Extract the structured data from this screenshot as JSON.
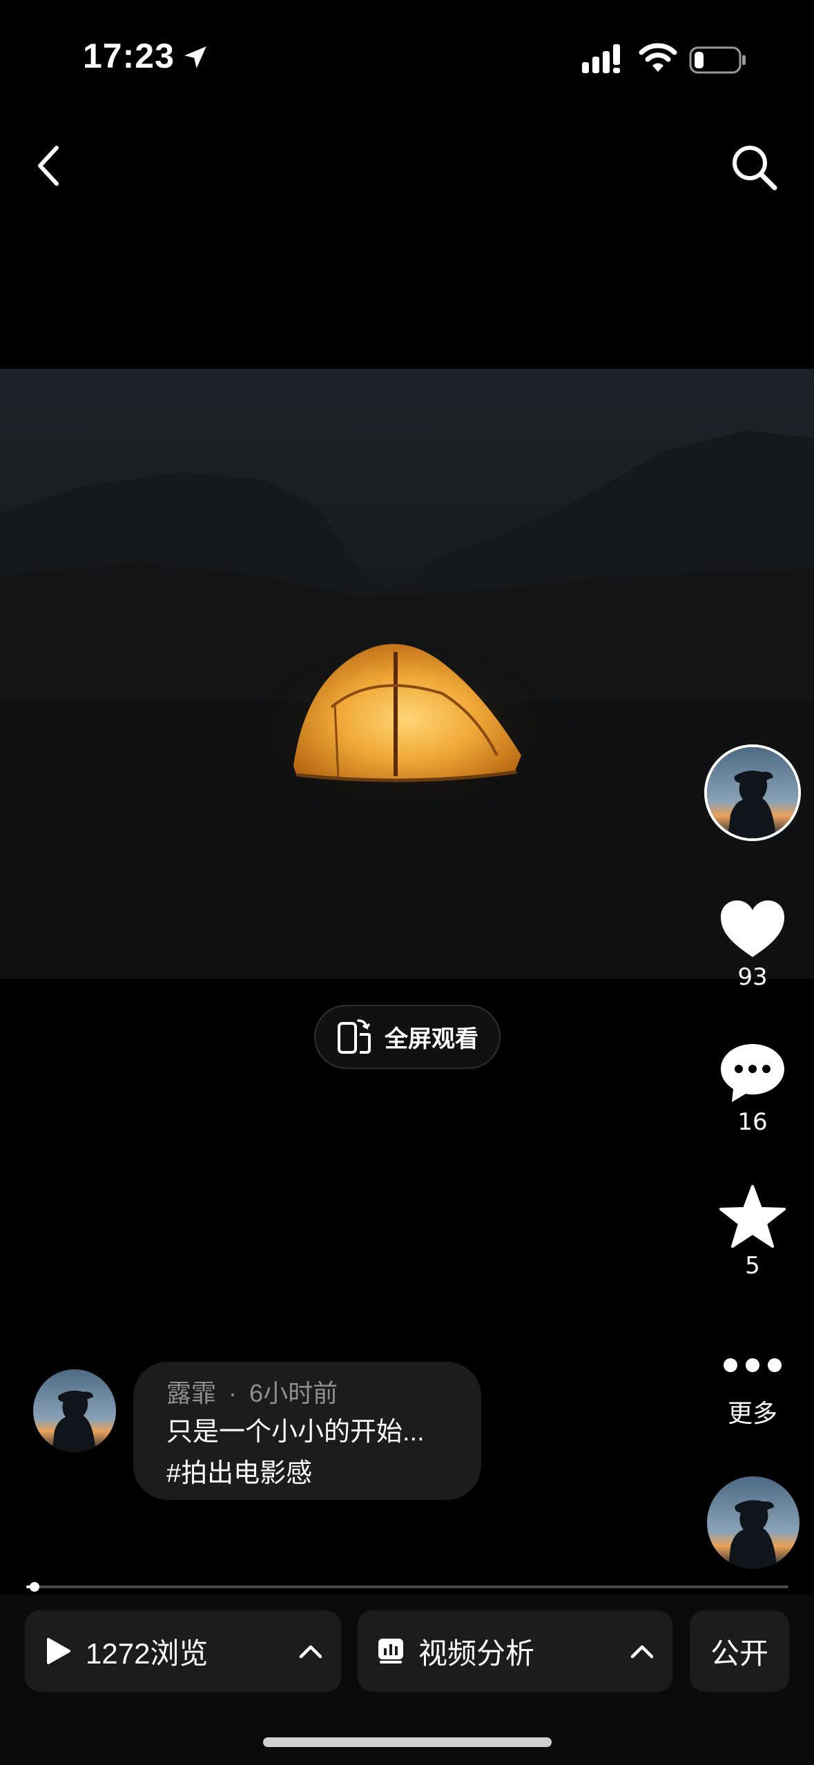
{
  "status_bar": {
    "time": "17:23"
  },
  "video": {
    "progress_fraction": 0.01
  },
  "fullscreen": {
    "label": "全屏观看"
  },
  "actions": {
    "likes": "93",
    "comments": "16",
    "favorites": "5",
    "more_label": "更多"
  },
  "caption": {
    "author": "露霏",
    "time_ago": "6小时前",
    "separator": "·",
    "line1": "只是一个小小的开始...",
    "line2": "#拍出电影感"
  },
  "bottom_bar": {
    "views": "1272浏览",
    "analysis": "视频分析",
    "visibility": "公开"
  },
  "icons": [
    "location-arrow-icon",
    "signal-icon",
    "wifi-icon",
    "battery-icon",
    "back-icon",
    "search-icon",
    "rotate-phone-icon",
    "heart-icon",
    "comment-icon",
    "star-icon",
    "more-dots-icon",
    "play-icon",
    "chevron-up-icon",
    "chart-icon"
  ]
}
